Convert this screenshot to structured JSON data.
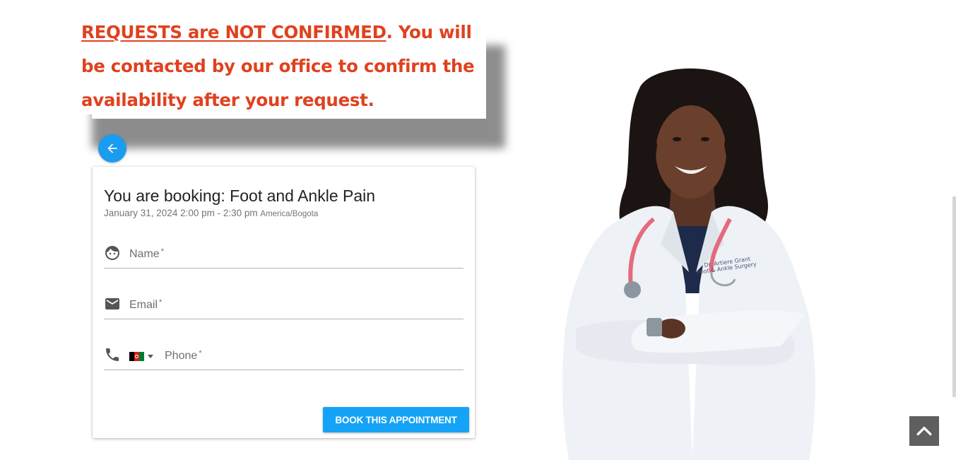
{
  "notice": {
    "underlined": "REQUESTS are NOT CONFIRMED",
    "rest": ". You will be contacted by our office to confirm the availability after your request."
  },
  "booking": {
    "title": "You are booking: Foot and Ankle Pain",
    "datetime": "January 31, 2024 2:00 pm - 2:30 pm",
    "timezone": "America/Bogota"
  },
  "form": {
    "name_label": "Name",
    "email_label": "Email",
    "phone_label": "Phone",
    "required_mark": "*",
    "submit_label": "BOOK THIS APPOINTMENT"
  },
  "doctor_coat_text": "Dr. Artiere Grant\nFoot & Ankle Surgery",
  "colors": {
    "notice_red": "#e0411f",
    "accent_blue": "#15a3f7",
    "back_blue": "#1a9cf0",
    "scroll_top_gray": "#5f5f5f"
  },
  "icons": {
    "back": "arrow-left-icon",
    "name": "face-icon",
    "email": "envelope-icon",
    "phone": "phone-icon",
    "scroll_top": "chevron-up-icon"
  }
}
